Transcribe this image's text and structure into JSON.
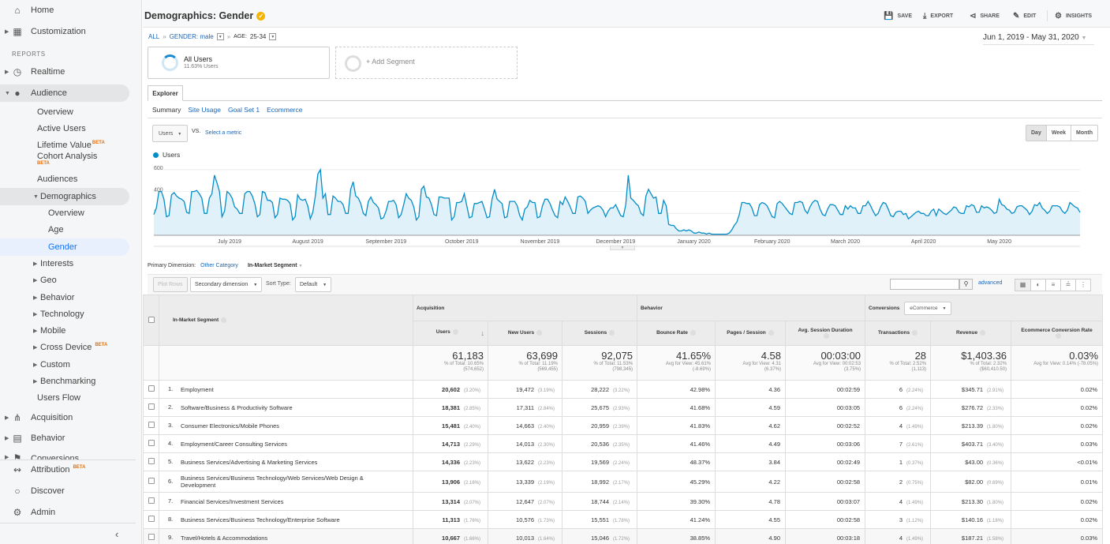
{
  "sidebar": {
    "items": [
      {
        "label": "Home",
        "icon": "home-icon"
      },
      {
        "label": "Customization",
        "icon": "dashboard-icon"
      },
      {
        "label": "Realtime",
        "icon": "clock-icon"
      },
      {
        "label": "Audience",
        "icon": "person-icon"
      },
      {
        "label": "Overview"
      },
      {
        "label": "Active Users"
      },
      {
        "label": "Lifetime Value",
        "badge": "BETA"
      },
      {
        "label": "Cohort Analysis",
        "badge": "BETA"
      },
      {
        "label": "Audiences"
      },
      {
        "label": "Demographics"
      },
      {
        "label": "Overview"
      },
      {
        "label": "Age"
      },
      {
        "label": "Gender"
      },
      {
        "label": "Interests"
      },
      {
        "label": "Geo"
      },
      {
        "label": "Behavior"
      },
      {
        "label": "Technology"
      },
      {
        "label": "Mobile"
      },
      {
        "label": "Cross Device",
        "badge": "BETA"
      },
      {
        "label": "Custom"
      },
      {
        "label": "Benchmarking"
      },
      {
        "label": "Users Flow"
      },
      {
        "label": "Acquisition",
        "icon": "acquisition-icon"
      },
      {
        "label": "Behavior",
        "icon": "behavior-icon"
      },
      {
        "label": "Conversions",
        "icon": "flag-icon"
      },
      {
        "label": "Attribution",
        "icon": "attribution-icon",
        "badge": "BETA"
      },
      {
        "label": "Discover",
        "icon": "lightbulb-icon"
      },
      {
        "label": "Admin",
        "icon": "gear-icon"
      }
    ],
    "reports_label": "REPORTS",
    "collapse_icon": "chevron-left-icon"
  },
  "header": {
    "title": "Demographics: Gender",
    "actions": {
      "save": "SAVE",
      "export": "EXPORT",
      "share": "SHARE",
      "edit": "EDIT",
      "insights": "INSIGHTS"
    },
    "breadcrumb": {
      "all": "ALL",
      "sep": "»",
      "gender": "GENDER: male",
      "age_key": "AGE:",
      "age_val": "25-34"
    },
    "date_range": "Jun 1, 2019 - May 31, 2020"
  },
  "segments": {
    "seg1_name": "All Users",
    "seg1_sub": "11.63% Users",
    "add": "+ Add Segment"
  },
  "tabs": {
    "explorer": "Explorer",
    "subtabs": [
      "Summary",
      "Site Usage",
      "Goal Set 1",
      "Ecommerce"
    ]
  },
  "chart_controls": {
    "metric": "Users",
    "vs": "VS.",
    "select_metric": "Select a metric",
    "granularity": [
      "Day",
      "Week",
      "Month"
    ],
    "legend": "Users"
  },
  "chart_data": {
    "type": "area",
    "title": "",
    "xlabel": "",
    "ylabel": "Users",
    "series_name": "Users",
    "ylim": [
      0,
      650
    ],
    "yticks": [
      200,
      400,
      600
    ],
    "x_start": "2019-06-01",
    "x_end": "2020-05-31",
    "xtick_labels": [
      "July 2019",
      "August 2019",
      "September 2019",
      "October 2019",
      "November 2019",
      "December 2019",
      "January 2020",
      "February 2020",
      "March 2020",
      "April 2020",
      "May 2020"
    ],
    "xtick_day_index": [
      30,
      61,
      92,
      122,
      153,
      183,
      214,
      245,
      274,
      305,
      335
    ],
    "color": "#058dc7",
    "fill": "#e1f1fa",
    "values": [
      190,
      250,
      400,
      400,
      330,
      170,
      180,
      370,
      390,
      360,
      340,
      330,
      310,
      210,
      200,
      400,
      400,
      410,
      380,
      340,
      200,
      200,
      340,
      380,
      550,
      480,
      400,
      170,
      220,
      400,
      380,
      340,
      260,
      240,
      200,
      200,
      380,
      400,
      400,
      360,
      290,
      170,
      190,
      400,
      390,
      320,
      320,
      300,
      160,
      190,
      340,
      330,
      330,
      320,
      290,
      140,
      170,
      370,
      330,
      320,
      330,
      270,
      150,
      210,
      360,
      560,
      600,
      340,
      380,
      190,
      190,
      360,
      340,
      310,
      310,
      280,
      200,
      200,
      420,
      490,
      360,
      340,
      290,
      200,
      180,
      310,
      350,
      300,
      280,
      250,
      150,
      160,
      220,
      310,
      310,
      320,
      280,
      160,
      190,
      280,
      380,
      340,
      320,
      260,
      140,
      170,
      420,
      450,
      350,
      340,
      280,
      190,
      180,
      350,
      350,
      340,
      340,
      340,
      140,
      170,
      300,
      300,
      310,
      380,
      270,
      160,
      170,
      290,
      290,
      300,
      310,
      240,
      160,
      170,
      330,
      420,
      330,
      310,
      290,
      160,
      170,
      310,
      310,
      310,
      270,
      180,
      140,
      240,
      260,
      320,
      300,
      300,
      160,
      170,
      270,
      330,
      330,
      290,
      230,
      180,
      160,
      310,
      280,
      350,
      310,
      260,
      200,
      200,
      350,
      360,
      340,
      310,
      200,
      230,
      250,
      260,
      270,
      260,
      230,
      170,
      220,
      250,
      250,
      280,
      230,
      180,
      170,
      280,
      550,
      340,
      320,
      290,
      270,
      200,
      180,
      360,
      420,
      380,
      340,
      350,
      200,
      200,
      320,
      270,
      100,
      90,
      90,
      60,
      40,
      40,
      50,
      40,
      50,
      40,
      20,
      20,
      30,
      20,
      20,
      10,
      20,
      10,
      10,
      10,
      10,
      10,
      10,
      10,
      20,
      50,
      90,
      120,
      190,
      300,
      300,
      290,
      290,
      250,
      180,
      180,
      280,
      300,
      290,
      270,
      220,
      170,
      160,
      290,
      310,
      290,
      260,
      230,
      200,
      190,
      300,
      300,
      310,
      300,
      230,
      200,
      260,
      300,
      320,
      310,
      240,
      190,
      180,
      240,
      280,
      280,
      270,
      230,
      190,
      190,
      270,
      240,
      270,
      250,
      250,
      200,
      200,
      270,
      270,
      310,
      270,
      220,
      180,
      200,
      260,
      300,
      290,
      240,
      180,
      170,
      210,
      220,
      220,
      190,
      200,
      150,
      170,
      190,
      210,
      220,
      200,
      200,
      180,
      180,
      220,
      240,
      180,
      240,
      220,
      200,
      190,
      210,
      230,
      260,
      250,
      210,
      200,
      200,
      270,
      260,
      280,
      270,
      210,
      210,
      270,
      250,
      260,
      250,
      230,
      200,
      210,
      330,
      280,
      270,
      240,
      230,
      200,
      210,
      260,
      270,
      270,
      250,
      230,
      190,
      220,
      280,
      270,
      300,
      250,
      230,
      200,
      220,
      270,
      270,
      270,
      260,
      220,
      200,
      230,
      300,
      280,
      260,
      250,
      210
    ]
  },
  "primary_dimension": {
    "label": "Primary Dimension:",
    "other": "Other Category",
    "current": "In-Market Segment"
  },
  "table_controls": {
    "plot_rows": "Plot Rows",
    "secondary_dimension": "Secondary dimension",
    "sort_type_label": "Sort Type:",
    "sort_type_value": "Default",
    "search_placeholder": "",
    "advanced": "advanced"
  },
  "table": {
    "dimension_header": "In-Market Segment",
    "groups": {
      "acquisition": "Acquisition",
      "behavior": "Behavior",
      "conversions": "Conversions",
      "conversions_select": "eCommerce"
    },
    "columns": [
      "Users",
      "New Users",
      "Sessions",
      "Bounce Rate",
      "Pages / Session",
      "Avg. Session Duration",
      "Transactions",
      "Revenue",
      "Ecommerce Conversion Rate"
    ],
    "totals": [
      {
        "value": "61,183",
        "l1": "% of Total: 10.65%",
        "l2": "(574,652)"
      },
      {
        "value": "63,699",
        "l1": "% of Total: 11.19%",
        "l2": "(569,455)"
      },
      {
        "value": "92,075",
        "l1": "% of Total: 11.53%",
        "l2": "(798,345)"
      },
      {
        "value": "41.65%",
        "l1": "Avg for View: 45.61%",
        "l2": "(-8.69%)"
      },
      {
        "value": "4.58",
        "l1": "Avg for View: 4.31",
        "l2": "(6.37%)"
      },
      {
        "value": "00:03:00",
        "l1": "Avg for View: 00:02:53",
        "l2": "(3.75%)"
      },
      {
        "value": "28",
        "l1": "% of Total: 2.52%",
        "l2": "(1,113)"
      },
      {
        "value": "$1,403.36",
        "l1": "% of Total: 2.32%",
        "l2": "($60,410.50)"
      },
      {
        "value": "0.03%",
        "l1": "Avg for View: 0.14% (-78.05%)",
        "l2": ""
      }
    ],
    "rows": [
      {
        "n": "1.",
        "name": "Employment",
        "users": "20,602",
        "users_pct": "(3.20%)",
        "new_users": "19,472",
        "new_users_pct": "(3.19%)",
        "sessions": "28,222",
        "sessions_pct": "(3.22%)",
        "bounce": "42.98%",
        "pps": "4.36",
        "dur": "00:02:59",
        "tx": "6",
        "tx_pct": "(2.24%)",
        "rev": "$345.71",
        "rev_pct": "(2.91%)",
        "cr": "0.02%"
      },
      {
        "n": "2.",
        "name": "Software/Business & Productivity Software",
        "users": "18,381",
        "users_pct": "(2.85%)",
        "new_users": "17,311",
        "new_users_pct": "(2.84%)",
        "sessions": "25,675",
        "sessions_pct": "(2.93%)",
        "bounce": "41.68%",
        "pps": "4.59",
        "dur": "00:03:05",
        "tx": "6",
        "tx_pct": "(2.24%)",
        "rev": "$276.72",
        "rev_pct": "(2.33%)",
        "cr": "0.02%"
      },
      {
        "n": "3.",
        "name": "Consumer Electronics/Mobile Phones",
        "users": "15,481",
        "users_pct": "(2.40%)",
        "new_users": "14,663",
        "new_users_pct": "(2.40%)",
        "sessions": "20,959",
        "sessions_pct": "(2.39%)",
        "bounce": "41.83%",
        "pps": "4.62",
        "dur": "00:02:52",
        "tx": "4",
        "tx_pct": "(1.49%)",
        "rev": "$213.39",
        "rev_pct": "(1.80%)",
        "cr": "0.02%"
      },
      {
        "n": "4.",
        "name": "Employment/Career Consulting Services",
        "users": "14,713",
        "users_pct": "(2.29%)",
        "new_users": "14,013",
        "new_users_pct": "(2.30%)",
        "sessions": "20,536",
        "sessions_pct": "(2.35%)",
        "bounce": "41.46%",
        "pps": "4.49",
        "dur": "00:03:06",
        "tx": "7",
        "tx_pct": "(2.61%)",
        "rev": "$403.71",
        "rev_pct": "(3.40%)",
        "cr": "0.03%"
      },
      {
        "n": "5.",
        "name": "Business Services/Advertising & Marketing Services",
        "users": "14,336",
        "users_pct": "(2.23%)",
        "new_users": "13,622",
        "new_users_pct": "(2.23%)",
        "sessions": "19,569",
        "sessions_pct": "(2.24%)",
        "bounce": "48.37%",
        "pps": "3.84",
        "dur": "00:02:49",
        "tx": "1",
        "tx_pct": "(0.37%)",
        "rev": "$43.00",
        "rev_pct": "(0.36%)",
        "cr": "<0.01%"
      },
      {
        "n": "6.",
        "name": "Business Services/Business Technology/Web Services/Web Design & Development",
        "users": "13,906",
        "users_pct": "(2.16%)",
        "new_users": "13,339",
        "new_users_pct": "(2.19%)",
        "sessions": "18,992",
        "sessions_pct": "(2.17%)",
        "bounce": "45.29%",
        "pps": "4.22",
        "dur": "00:02:58",
        "tx": "2",
        "tx_pct": "(0.75%)",
        "rev": "$82.00",
        "rev_pct": "(0.69%)",
        "cr": "0.01%"
      },
      {
        "n": "7.",
        "name": "Financial Services/Investment Services",
        "users": "13,314",
        "users_pct": "(2.07%)",
        "new_users": "12,647",
        "new_users_pct": "(2.07%)",
        "sessions": "18,744",
        "sessions_pct": "(2.14%)",
        "bounce": "39.30%",
        "pps": "4.78",
        "dur": "00:03:07",
        "tx": "4",
        "tx_pct": "(1.49%)",
        "rev": "$213.30",
        "rev_pct": "(1.80%)",
        "cr": "0.02%"
      },
      {
        "n": "8.",
        "name": "Business Services/Business Technology/Enterprise Software",
        "users": "11,313",
        "users_pct": "(1.76%)",
        "new_users": "10,576",
        "new_users_pct": "(1.73%)",
        "sessions": "15,551",
        "sessions_pct": "(1.78%)",
        "bounce": "41.24%",
        "pps": "4.55",
        "dur": "00:02:58",
        "tx": "3",
        "tx_pct": "(1.12%)",
        "rev": "$140.16",
        "rev_pct": "(1.18%)",
        "cr": "0.02%"
      },
      {
        "n": "9.",
        "name": "Travel/Hotels & Accommodations",
        "users": "10,667",
        "users_pct": "(1.66%)",
        "new_users": "10,013",
        "new_users_pct": "(1.64%)",
        "sessions": "15,046",
        "sessions_pct": "(1.72%)",
        "bounce": "38.85%",
        "pps": "4.90",
        "dur": "00:03:18",
        "tx": "4",
        "tx_pct": "(1.49%)",
        "rev": "$187.21",
        "rev_pct": "(1.58%)",
        "cr": "0.03%"
      }
    ]
  }
}
